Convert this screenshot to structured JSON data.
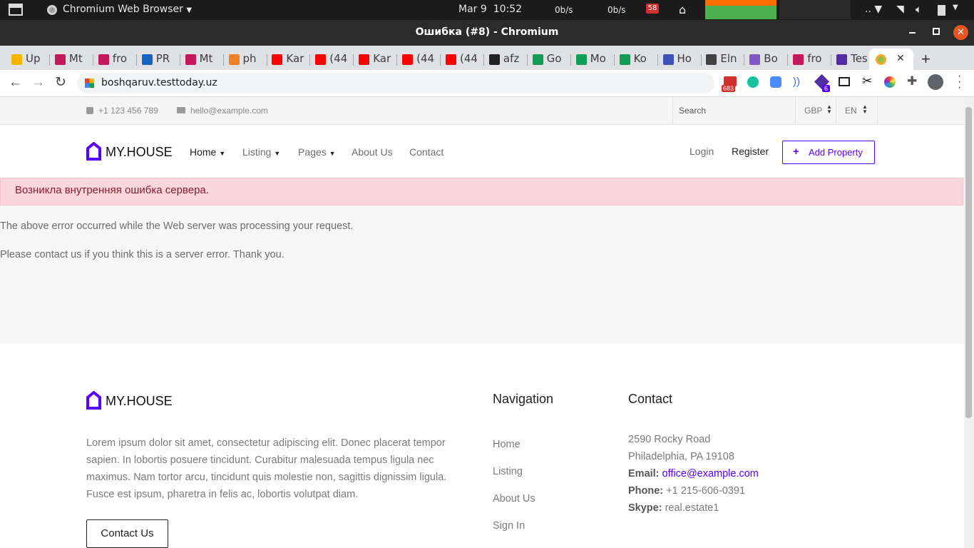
{
  "os_bar": {
    "app_name": "Chromium Web Browser",
    "date": "Mar 9",
    "time": "10:52",
    "net_down": "0b/s",
    "net_up": "0b/s",
    "badge": "58",
    "tray_more": ".."
  },
  "window": {
    "title": "Ошибка (#8) - Chromium"
  },
  "tabs": [
    {
      "label": "Up",
      "color": "#f4b400"
    },
    {
      "label": "Mt",
      "color": "#c2185b"
    },
    {
      "label": "fro",
      "color": "#c2185b"
    },
    {
      "label": "PR",
      "color": "#1565c0"
    },
    {
      "label": "Mt",
      "color": "#c2185b"
    },
    {
      "label": "ph",
      "color": "#f48024"
    },
    {
      "label": "Kar",
      "color": "#ff0000"
    },
    {
      "label": "(44",
      "color": "#ff0000"
    },
    {
      "label": "Kar",
      "color": "#ff0000"
    },
    {
      "label": "(44",
      "color": "#ff0000"
    },
    {
      "label": "(44",
      "color": "#ff0000"
    },
    {
      "label": "afz",
      "color": "#222222"
    },
    {
      "label": "Go",
      "color": "#0f9d58"
    },
    {
      "label": "Mo",
      "color": "#0f9d58"
    },
    {
      "label": "Ko",
      "color": "#0f9d58"
    },
    {
      "label": "Ho",
      "color": "#3f51b5"
    },
    {
      "label": "Eln",
      "color": "#424242"
    },
    {
      "label": "Bo",
      "color": "#7e57c2"
    },
    {
      "label": "fro",
      "color": "#c2185b"
    },
    {
      "label": "Tes",
      "color": "#512da8"
    }
  ],
  "address": {
    "url": "boshqaruv.testtoday.uz",
    "ext_badge_mail": "683",
    "ext_badge_six": "6"
  },
  "site": {
    "phone": "+1 123 456 789",
    "email": "hello@example.com",
    "search_label": "Search",
    "currency": "GBP",
    "language": "EN",
    "brand": "MY.HOUSE",
    "menu": {
      "home": "Home",
      "listing": "Listing",
      "pages": "Pages",
      "about": "About Us",
      "contact": "Contact"
    },
    "login": "Login",
    "register": "Register",
    "add_property": "Add Property"
  },
  "error": {
    "alert": "Возникла внутренняя ошибка сервера.",
    "line1": "The above error occurred while the Web server was processing your request.",
    "line2": "Please contact us if you think this is a server error. Thank you."
  },
  "footer": {
    "brand": "MY.HOUSE",
    "about": "Lorem ipsum dolor sit amet, consectetur adipiscing elit. Donec placerat tempor sapien. In lobortis posuere tincidunt. Curabitur malesuada tempus ligula nec maximus. Nam tortor arcu, tincidunt quis molestie non, sagittis dignissim ligula. Fusce est ipsum, pharetra in felis ac, lobortis volutpat diam.",
    "contact_button": "Contact Us",
    "nav_title": "Navigation",
    "nav_links": [
      "Home",
      "Listing",
      "About Us",
      "Sign In"
    ],
    "contact_title": "Contact",
    "address_line1": "2590 Rocky Road",
    "address_line2": "Philadelphia, PA 19108",
    "email_label": "Email:",
    "email": "office@example.com",
    "phone_label": "Phone:",
    "phone": "+1 215-606-0391",
    "skype_label": "Skype:",
    "skype": "real.estate1"
  },
  "colors": {
    "brand_purple": "#5b00ff",
    "alert_bg": "#fcd6dc",
    "alert_text": "#841e2d"
  }
}
